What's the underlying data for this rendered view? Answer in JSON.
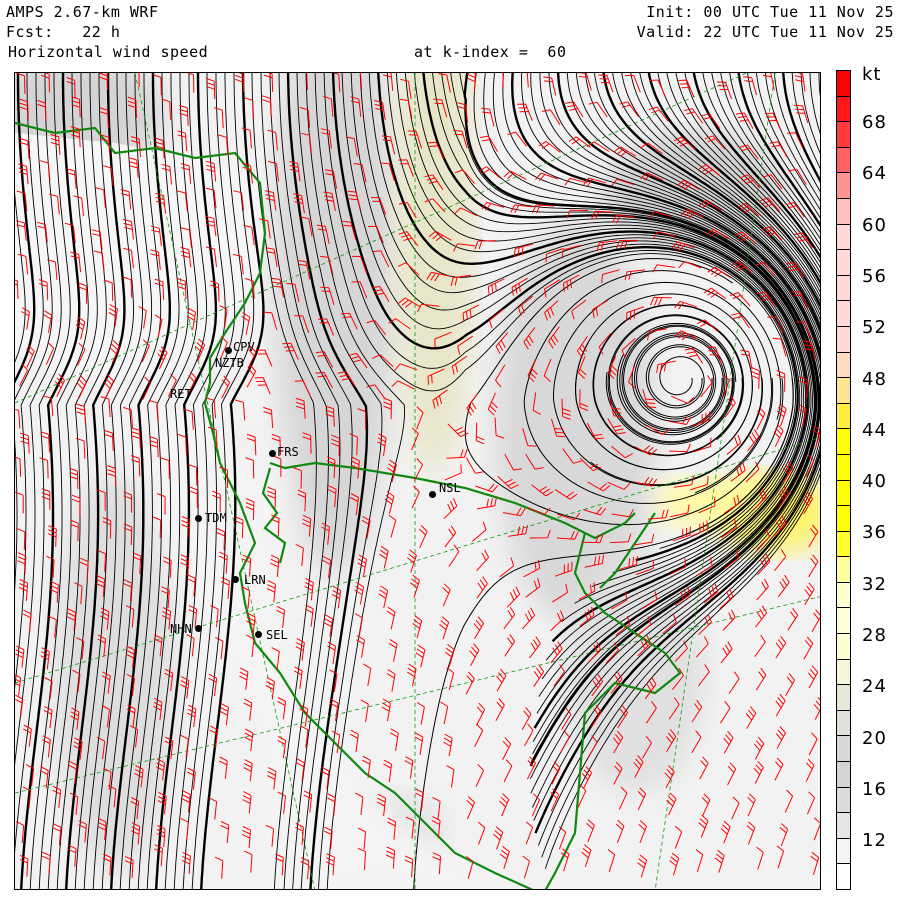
{
  "header": {
    "model": "AMPS 2.67-km WRF",
    "forecast": "Fcst:   22 h",
    "field": "Horizontal wind speed",
    "level": "at k-index =  60",
    "init": "Init: 00 UTC Tue 11 Nov 25",
    "valid": "Valid: 22 UTC Tue 11 Nov 25"
  },
  "colorbar": {
    "unit": "kt",
    "labels": [
      "68",
      "64",
      "60",
      "56",
      "52",
      "48",
      "44",
      "40",
      "36",
      "32",
      "28",
      "24",
      "20",
      "16",
      "12"
    ],
    "colors": [
      "#ff0000",
      "#ff1a1a",
      "#ff3c3c",
      "#ff6262",
      "#ff9494",
      "#ffc0c0",
      "#ffd8d8",
      "#ffd8d8",
      "#ffd8d8",
      "#ffd8d8",
      "#ffd8d8",
      "#ffdcc0",
      "#ffe490",
      "#ffec40",
      "#ffff00",
      "#ffff00",
      "#ffff00",
      "#ffff00",
      "#ffff30",
      "#ffff9c",
      "#ffffd0",
      "#ffffd8",
      "#ffffd4",
      "#f6f6da",
      "#e8e8d8",
      "#e0e0dc",
      "#d8d8d8",
      "#d4d4d4",
      "#dcdcdc",
      "#e6e6e6",
      "#f4f4f4",
      "#ffffff"
    ]
  },
  "stations": [
    "CPV",
    "NZTB",
    "RET",
    "FRS",
    "TDM",
    "LRN",
    "NHN",
    "SEL",
    "NSL"
  ],
  "colors": {
    "streamline": "#000000",
    "barb": "#ff0000",
    "coast": "#118811",
    "grid": "#119911"
  }
}
